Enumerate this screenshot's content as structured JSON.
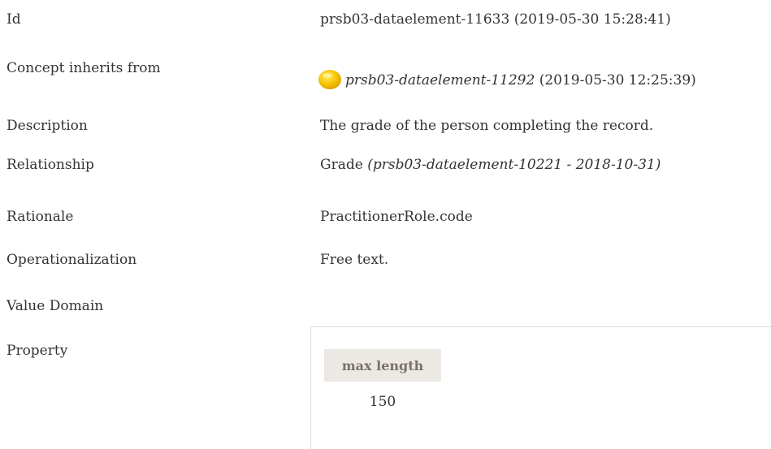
{
  "rows": [
    {
      "label": "Id",
      "value": "prsb03-dataelement-11633 (2019-05-30 15:28:41)"
    },
    {
      "label": "Concept inherits from",
      "value_link": "prsb03-dataelement-11292",
      "value_suffix": " (2019-05-30 12:25:39)",
      "icon": "yellow-orb-icon"
    },
    {
      "label": "Description",
      "value": "The grade of the person completing the record."
    },
    {
      "label": "Relationship",
      "value_main": "Grade ",
      "value_ital": "(prsb03-dataelement-10221 - 2018-10-31)"
    },
    {
      "label": "Rationale",
      "value": "PractitionerRole.code"
    },
    {
      "label": "Operationalization",
      "value": "Free text."
    },
    {
      "label": "Value Domain",
      "value": ""
    },
    {
      "label": "Property"
    }
  ],
  "property_table": {
    "header": "max length",
    "value": "150"
  },
  "colors": {
    "text": "#333333",
    "header_bg": "#ece9e4",
    "header_text": "#7a716a",
    "orb": "#f5c200"
  }
}
